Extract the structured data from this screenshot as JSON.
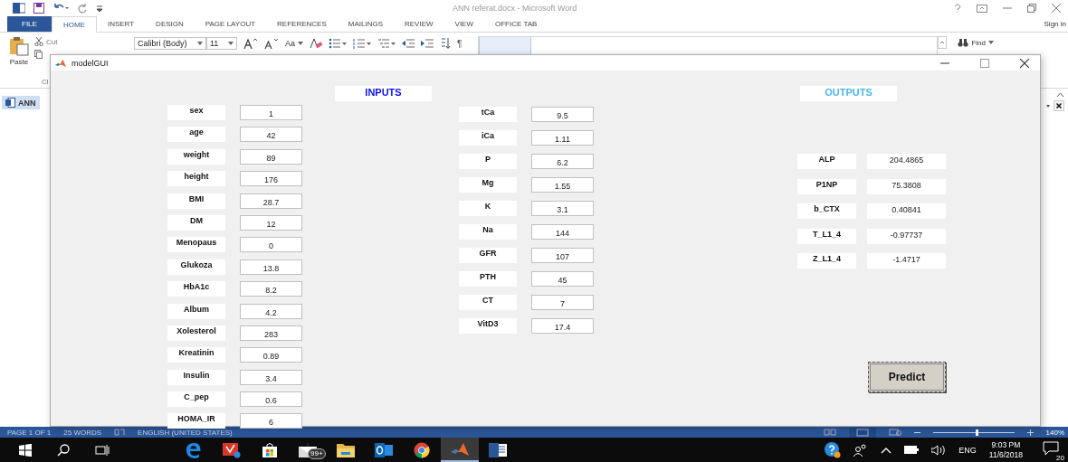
{
  "word": {
    "title": "ANN referat.docx - Microsoft Word",
    "tabs": [
      {
        "label": "FILE",
        "kind": "file",
        "selected": false
      },
      {
        "label": "HOME",
        "kind": "tab",
        "selected": true
      },
      {
        "label": "INSERT",
        "kind": "tab",
        "selected": false
      },
      {
        "label": "DESIGN",
        "kind": "tab",
        "selected": false
      },
      {
        "label": "PAGE LAYOUT",
        "kind": "tab",
        "selected": false
      },
      {
        "label": "REFERENCES",
        "kind": "tab",
        "selected": false
      },
      {
        "label": "MAILINGS",
        "kind": "tab",
        "selected": false
      },
      {
        "label": "REVIEW",
        "kind": "tab",
        "selected": false
      },
      {
        "label": "VIEW",
        "kind": "tab",
        "selected": false
      },
      {
        "label": "OFFICE TAB",
        "kind": "tab",
        "selected": false
      }
    ],
    "sign_in": "Sign in",
    "ribbon": {
      "paste": "Paste",
      "cut": "Cut",
      "clipboard_group": "Cl",
      "font": "Calibri (Body)",
      "size": "11",
      "change_case": "Aa",
      "pilcrow": "¶",
      "find": "Find"
    },
    "doc_tab": "ANN",
    "status_bar": {
      "page": "PAGE 1 OF 1",
      "words": "25 WORDS",
      "language": "ENGLISH (UNITED STATES)",
      "zoom_slider": {
        "level": 0.54
      },
      "zoom": "140%"
    }
  },
  "gui": {
    "title": "modelGUI",
    "inputs_heading": "INPUTS",
    "outputs_heading": "OUTPUTS",
    "inputs_left": [
      {
        "label": "sex",
        "value": "1"
      },
      {
        "label": "age",
        "value": "42"
      },
      {
        "label": "weight",
        "value": "89"
      },
      {
        "label": "height",
        "value": "176"
      },
      {
        "label": "BMI",
        "value": "28.7"
      },
      {
        "label": "DM",
        "value": "12"
      },
      {
        "label": "Menopaus",
        "value": "0"
      },
      {
        "label": "Glukoza",
        "value": "13.8"
      },
      {
        "label": "HbA1c",
        "value": "8.2"
      },
      {
        "label": "Album",
        "value": "4.2"
      },
      {
        "label": "Xolesterol",
        "value": "283"
      },
      {
        "label": "Kreatinin",
        "value": "0.89"
      },
      {
        "label": "Insulin",
        "value": "3.4"
      },
      {
        "label": "C_pep",
        "value": "0.6"
      },
      {
        "label": "HOMA_IR",
        "value": "6"
      }
    ],
    "inputs_right": [
      {
        "label": "tCa",
        "value": "9.5"
      },
      {
        "label": "iCa",
        "value": "1.11"
      },
      {
        "label": "P",
        "value": "6.2"
      },
      {
        "label": "Mg",
        "value": "1.55"
      },
      {
        "label": "K",
        "value": "3.1"
      },
      {
        "label": "Na",
        "value": "144"
      },
      {
        "label": "GFR",
        "value": "107"
      },
      {
        "label": "PTH",
        "value": "45"
      },
      {
        "label": "CT",
        "value": "7"
      },
      {
        "label": "VitD3",
        "value": "17.4"
      }
    ],
    "outputs": [
      {
        "label": "ALP",
        "value": "204.4865"
      },
      {
        "label": "P1NP",
        "value": "75.3808"
      },
      {
        "label": "b_CTX",
        "value": "0.40841"
      },
      {
        "label": "T_L1_4",
        "value": "-0.97737"
      },
      {
        "label": "Z_L1_4",
        "value": "-1.4717"
      }
    ],
    "predict": "Predict"
  },
  "taskbar": {
    "apps": [
      {
        "kind": "edge",
        "active": false
      },
      {
        "kind": "shield",
        "active": false
      },
      {
        "kind": "store",
        "active": false
      },
      {
        "kind": "mail",
        "active": false,
        "badge": "99+"
      },
      {
        "kind": "folder",
        "active": false
      },
      {
        "kind": "outlook",
        "active": false
      },
      {
        "kind": "chrome",
        "active": false
      },
      {
        "kind": "matlab",
        "active": true
      },
      {
        "kind": "word",
        "active": false
      }
    ],
    "language": "ENG",
    "time": "9:03 PM",
    "date": "11/6/2018",
    "notifications": "20"
  }
}
